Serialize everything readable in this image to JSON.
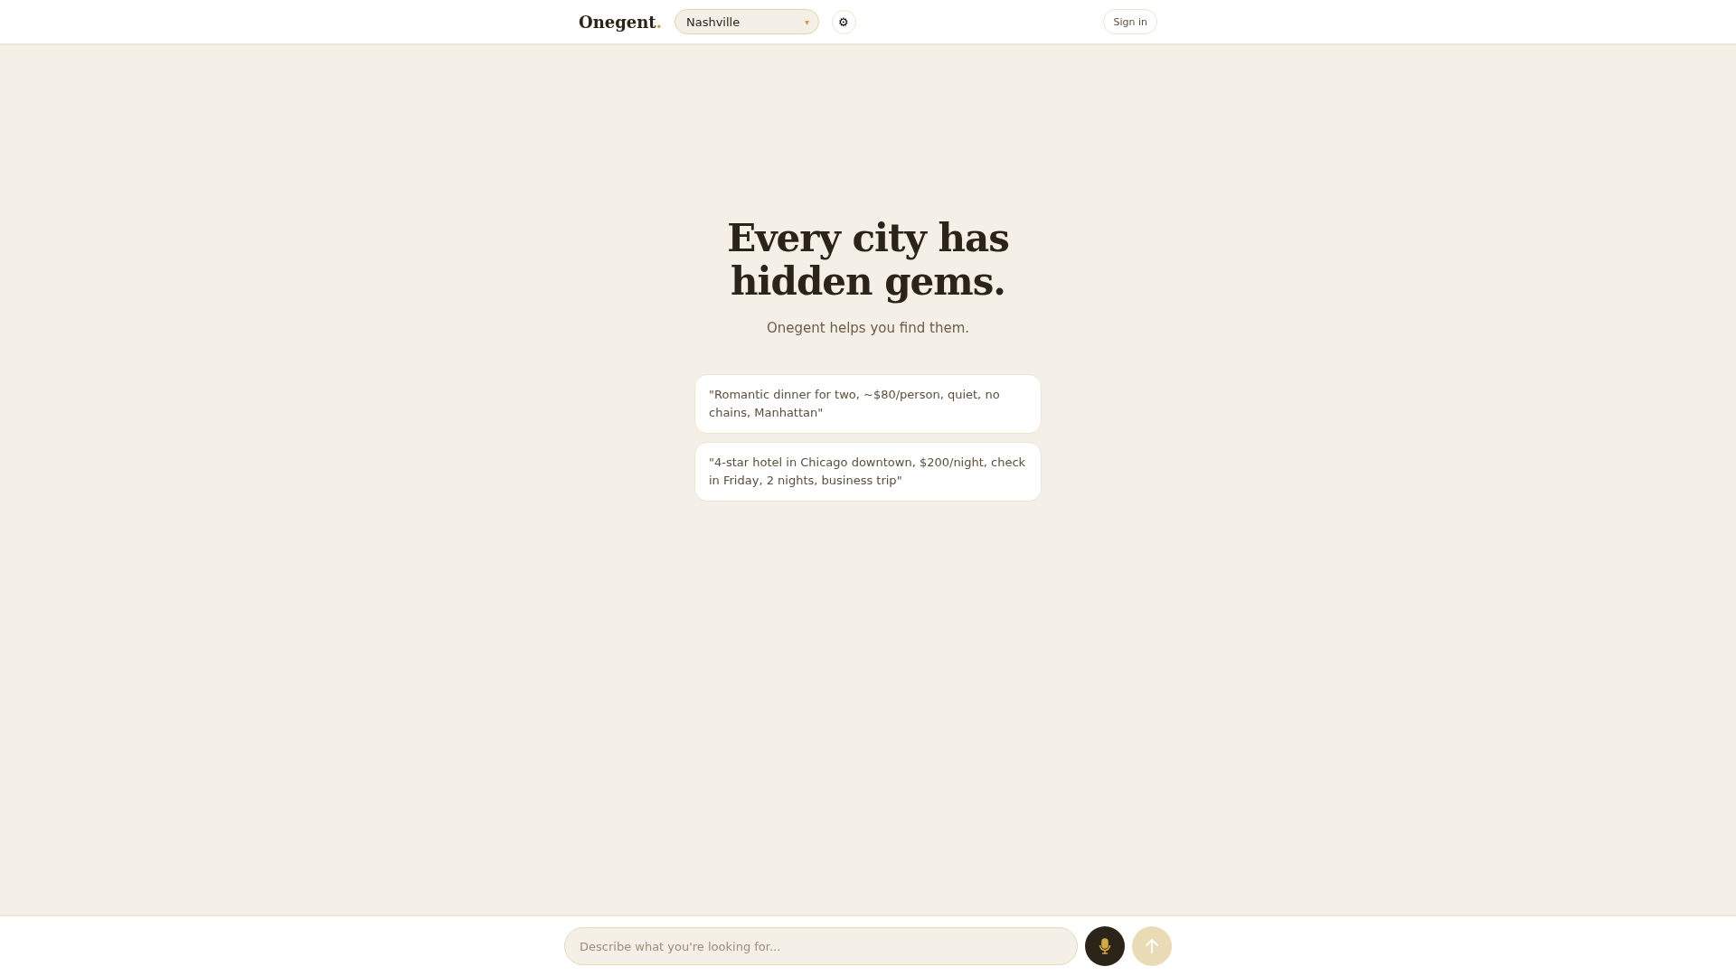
{
  "header": {
    "logo": {
      "name": "Onegent",
      "mark": "."
    },
    "city_select": {
      "value": "Nashville",
      "caret": "▾"
    },
    "settings_icon": "⚙",
    "sign_in": "Sign in"
  },
  "hero": {
    "title_lines": [
      "Every city has",
      "hidden gems."
    ],
    "subtitle": "Onegent helps you find them."
  },
  "suggestions": [
    {
      "text": "\"Romantic dinner for two, ~$80/person, quiet, no chains, Manhattan\""
    },
    {
      "text": "\"4-star hotel in Chicago downtown, $200/night, check in Friday, 2 nights, business trip\""
    }
  ],
  "composer": {
    "placeholder": "Describe what you're looking for...",
    "send_disabled": true
  }
}
